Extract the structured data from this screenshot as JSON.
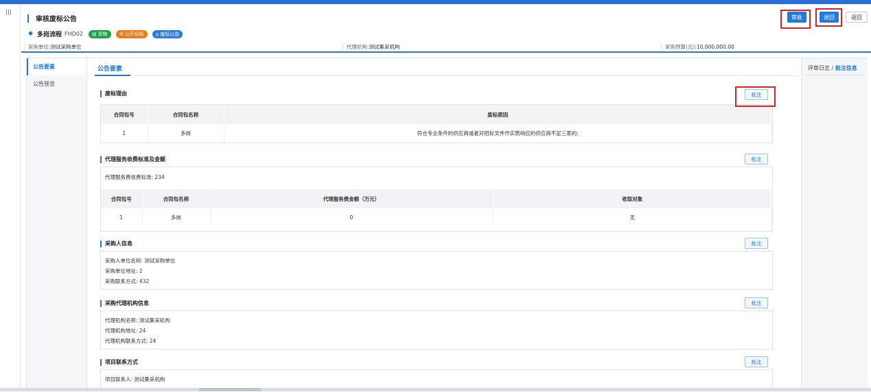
{
  "header": {
    "title": "审核废标公告",
    "buttons": {
      "approve": "审批",
      "return": "退回",
      "back": "返回"
    },
    "flow": {
      "name": "多岗流程",
      "code": "FHD02",
      "tags": [
        "货物",
        "公开招标",
        "废标公告"
      ]
    },
    "info": {
      "buyer_label": "采购单位:",
      "buyer_value": "测试采购单位",
      "agency_label": "代理机构:",
      "agency_value": "测试集采机构",
      "budget_label": "采购预算(元):",
      "budget_value": "10,000,000.00"
    }
  },
  "subnav": {
    "items": [
      "公告要素",
      "公告预览"
    ]
  },
  "content": {
    "tab": "公告要素",
    "annotate_label": "批注",
    "sections": {
      "reason": {
        "title": "废标理由",
        "headers": [
          "合同包号",
          "合同包名称",
          "废标原因"
        ],
        "rows": [
          [
            "1",
            "多岗",
            "符合专业条件的供应商或者对招标文件作实质响应的供应商不足三家的;"
          ]
        ]
      },
      "fee": {
        "title": "代理服务收费标准及金额",
        "standard": "代理服务费收费标准: 234",
        "headers": [
          "合同包号",
          "合同包名称",
          "代理服务费金额（万元）",
          "收取对象"
        ],
        "rows": [
          [
            "1",
            "多岗",
            "0",
            "无"
          ]
        ]
      },
      "buyer": {
        "title": "采购人信息",
        "lines": [
          "采购人单位名称: 测试采购单位",
          "采购单位地址: 2",
          "采购联系方式: 432"
        ]
      },
      "agency": {
        "title": "采购代理机构信息",
        "lines": [
          "代理机构名称: 测试集采机构",
          "代理机构地址: 24",
          "代理机构联系方式: 24"
        ]
      },
      "contact": {
        "title": "项目联系方式",
        "lines": [
          "项目联系人: 测试集采机构"
        ]
      }
    }
  },
  "rightpanel": {
    "log": "评审日志 /",
    "annotations": "批注信息"
  },
  "colors": {
    "primary": "#1f7ae0",
    "highlight": "#e02020"
  }
}
